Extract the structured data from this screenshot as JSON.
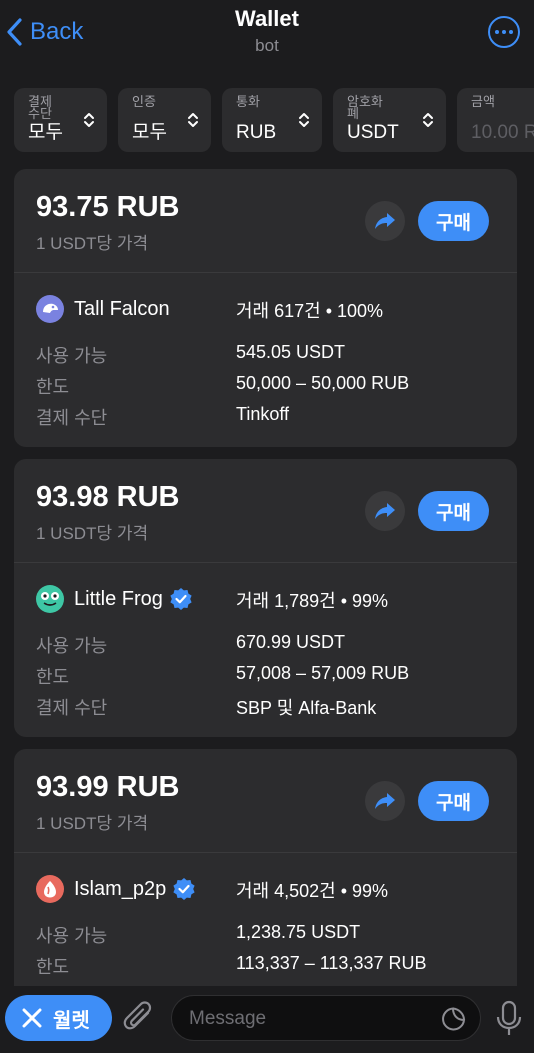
{
  "header": {
    "back_label": "Back",
    "title": "Wallet",
    "subtitle": "bot"
  },
  "filters": [
    {
      "label": "결제\n수단",
      "value": "모두"
    },
    {
      "label": "인증",
      "value": "모두"
    },
    {
      "label": "통화",
      "value": "RUB"
    },
    {
      "label": "암호화\n폐",
      "value": "USDT"
    },
    {
      "label": "금액",
      "value": "10.00 R"
    }
  ],
  "offers": [
    {
      "price": "93.75 RUB",
      "price_sub": "1 USDT당 가격",
      "buy_label": "구매",
      "seller": "Tall Falcon",
      "verified": false,
      "stats": "거래 617건 • 100%",
      "available_label": "사용 가능",
      "available": "545.05 USDT",
      "limit_label": "한도",
      "limit": "50,000 – 50,000 RUB",
      "method_label": "결제 수단",
      "method": "Tinkoff"
    },
    {
      "price": "93.98 RUB",
      "price_sub": "1 USDT당 가격",
      "buy_label": "구매",
      "seller": "Little Frog",
      "verified": true,
      "stats": "거래 1,789건 • 99%",
      "available_label": "사용 가능",
      "available": "670.99 USDT",
      "limit_label": "한도",
      "limit": "57,008 – 57,009 RUB",
      "method_label": "결제 수단",
      "method": "SBP 및 Alfa-Bank"
    },
    {
      "price": "93.99 RUB",
      "price_sub": "1 USDT당 가격",
      "buy_label": "구매",
      "seller": "Islam_p2p",
      "verified": true,
      "stats": "거래 4,502건 • 99%",
      "available_label": "사용 가능",
      "available": "1,238.75 USDT",
      "limit_label": "한도",
      "limit": "113,337 – 113,337 RUB"
    }
  ],
  "bottom": {
    "wallet_label": "월렛",
    "message_placeholder": "Message"
  },
  "colors": {
    "accent": "#3e8ef7",
    "card": "#2c2c2e",
    "background": "#1c1c1e"
  }
}
